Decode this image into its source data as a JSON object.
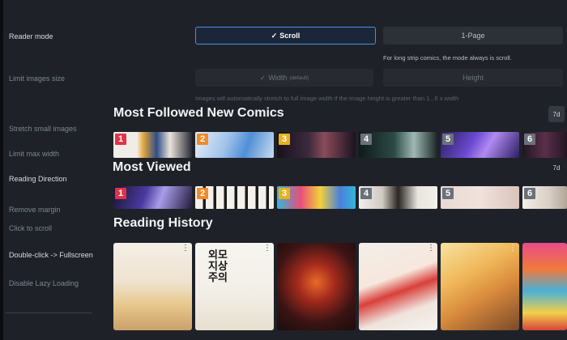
{
  "settings": {
    "reader_mode_label": "Reader mode",
    "scroll_label": "Scroll",
    "one_page_label": "1-Page",
    "reader_mode_hint": "For long strip comics, the mode always is scroll.",
    "limit_images_size_label": "Limit images size",
    "width_label": "Width",
    "width_default": "(default)",
    "height_label": "Height",
    "limit_hint": "Images will automatically stretch to full image width if the image height is greater than 1...6 x width",
    "stretch_small_images_label": "Stretch small images",
    "limit_max_width_label": "Limit max width",
    "reading_direction_label": "Reading Direction",
    "remove_margin_label": "Remove margin",
    "click_to_scroll_label": "Click to scroll",
    "double_click_label": "Double-click -> Fullscreen",
    "disable_lazy_loading_label": "Disable Lazy Loading"
  },
  "most_followed": {
    "title": "Most Followed New Comics",
    "period": "7d",
    "ranks": [
      "1",
      "2",
      "3",
      "4",
      "5",
      "6"
    ],
    "rank_colors": [
      "#e0334a",
      "#f08a2b",
      "#e8b21c",
      "#6b717a",
      "#6b717a",
      "#6b717a"
    ]
  },
  "most_viewed": {
    "title": "Most Viewed",
    "period": "7d",
    "ranks": [
      "1",
      "2",
      "3",
      "4",
      "5",
      "6"
    ],
    "rank_colors": [
      "#e0334a",
      "#f08a2b",
      "#e8b21c",
      "#6b717a",
      "#6b717a",
      "#6b717a"
    ]
  },
  "reading_history": {
    "title": "Reading History",
    "covers": [
      {
        "text": "",
        "menu": "⋮"
      },
      {
        "text": "외모 지상 주의",
        "menu": "⋮"
      },
      {
        "text": "",
        "menu": ""
      },
      {
        "text": "",
        "menu": "⋮"
      },
      {
        "text": "",
        "menu": "⋮"
      },
      {
        "text": "",
        "menu": ""
      }
    ]
  },
  "colors": {
    "accent": "#4a90e2",
    "background": "#1e2228"
  }
}
